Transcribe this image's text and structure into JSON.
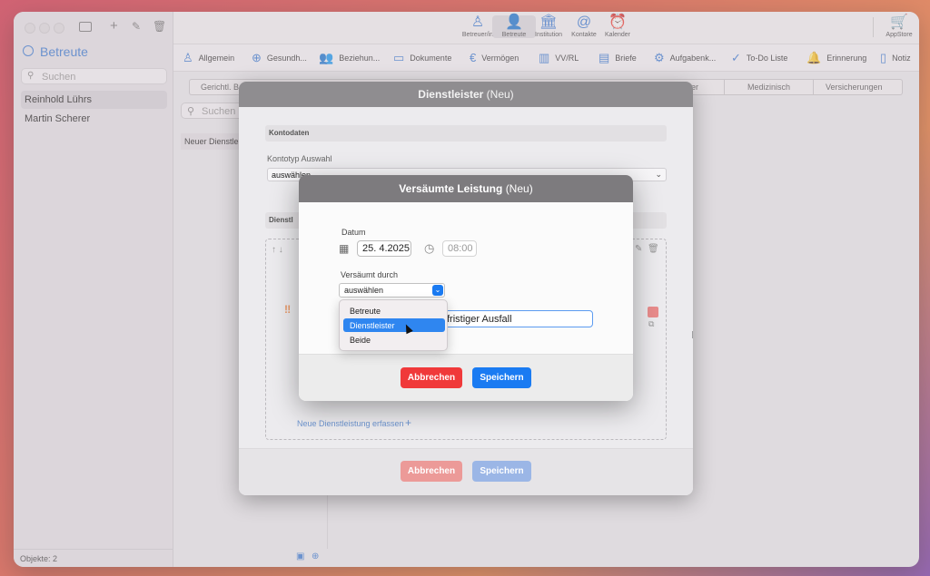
{
  "sidebar": {
    "title": "Betreute",
    "search_placeholder": "Suchen",
    "items": [
      "Reinhold Lührs",
      "Martin Scherer"
    ],
    "footer": "Objekte: 2"
  },
  "toolbar": {
    "items": [
      {
        "label": "Betreuer/in",
        "icon": "person-badge-icon"
      },
      {
        "label": "Betreute",
        "icon": "person-icon"
      },
      {
        "label": "Institution",
        "icon": "bank-icon"
      },
      {
        "label": "Kontakte",
        "icon": "at-icon"
      },
      {
        "label": "Kalender",
        "icon": "alarm-icon"
      }
    ],
    "appstore": "AppStore"
  },
  "nav": {
    "items": [
      {
        "label": "Allgemein",
        "icon": "person-outline-icon"
      },
      {
        "label": "Gesundh...",
        "icon": "medical-bag-icon"
      },
      {
        "label": "Beziehun...",
        "icon": "people-icon"
      },
      {
        "label": "Dokumente",
        "icon": "folder-icon"
      },
      {
        "label": "Vermögen",
        "icon": "euro-icon"
      },
      {
        "label": "VV/RL",
        "icon": "building-icon"
      },
      {
        "label": "Briefe",
        "icon": "document-icon"
      },
      {
        "label": "Aufgabenk...",
        "icon": "task-gear-icon"
      },
      {
        "label": "To-Do Liste",
        "icon": "checkmark-circle-icon"
      },
      {
        "label": "Erinnerung",
        "icon": "bell-icon"
      },
      {
        "label": "Notiz",
        "icon": "note-icon"
      }
    ]
  },
  "subtabs": [
    "Gerichtl. Be",
    "er",
    "Medizinisch",
    "Versicherungen"
  ],
  "middle": {
    "search_placeholder": "Suchen",
    "row": "Neuer Dienstlei"
  },
  "outer_dialog": {
    "title": "Dienstleister",
    "title_suffix": "(Neu)",
    "section1": "Kontodaten",
    "kontotyp_label": "Kontotyp Auswahl",
    "kontotyp_value": "auswählen",
    "section2": "Dienstl",
    "new_service_link": "Neue Dienstleistung erfassen",
    "plus": "+",
    "cancel": "Abbrechen",
    "save": "Speichern",
    "bg_text": "n"
  },
  "inner_dialog": {
    "title": "Versäumte Leistung",
    "title_suffix": "(Neu)",
    "date_label": "Datum",
    "date_value": "25.  4.2025",
    "time_value": "08:00",
    "by_label": "Versäumt durch",
    "select_value": "auswählen",
    "reason_value": "fristiger Ausfall",
    "cancel": "Abbrechen",
    "save": "Speichern"
  },
  "dropdown": {
    "options": [
      "Betreute",
      "Dienstleister",
      "Beide"
    ],
    "selected": "Dienstleister"
  },
  "colors": {
    "accent": "#1a7bf2",
    "cancel": "#f0393a",
    "sidebar_title": "#3a7bd5"
  }
}
